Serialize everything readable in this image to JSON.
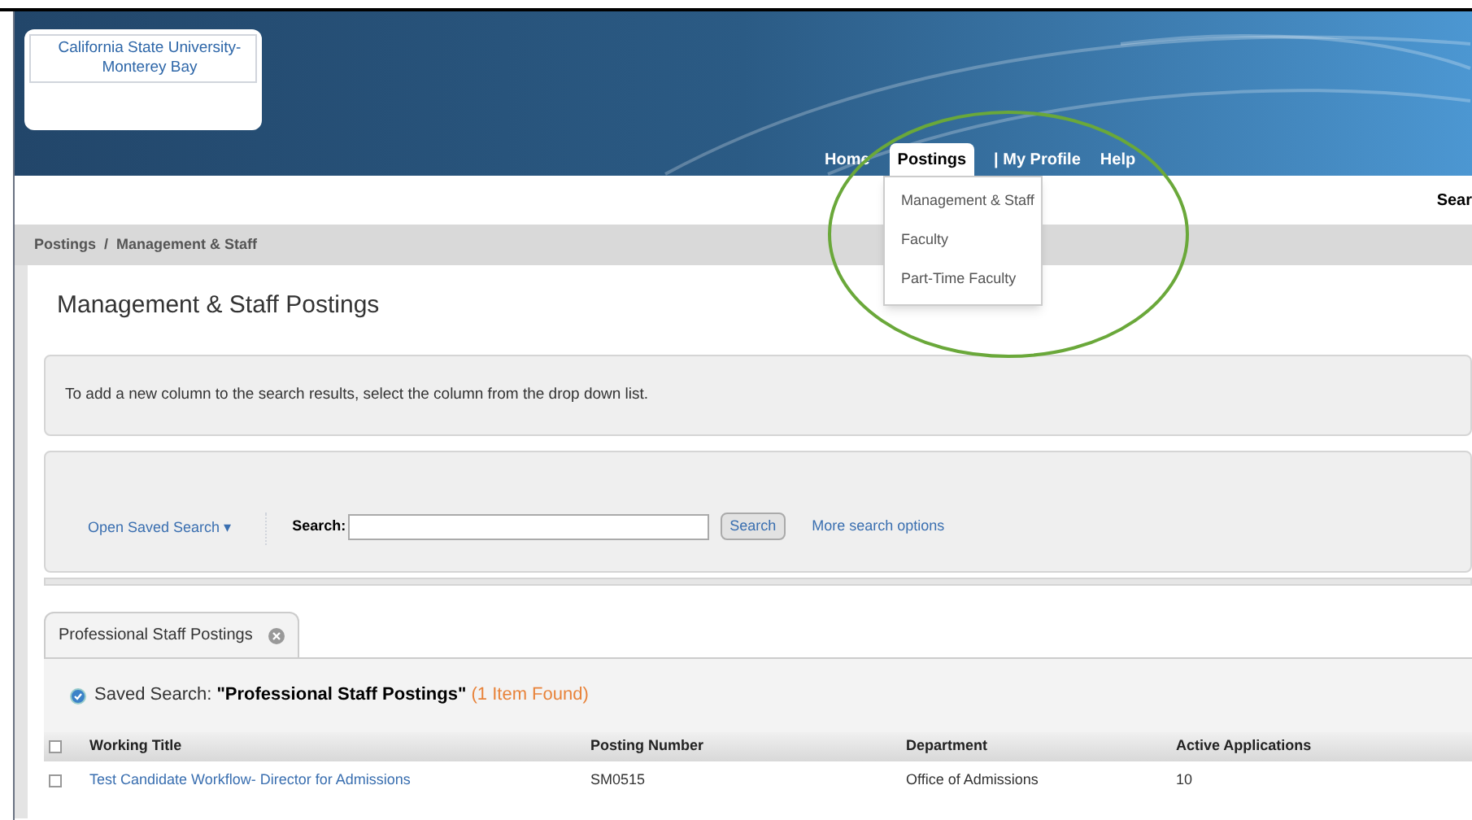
{
  "logo": {
    "alt_lines": [
      "California State University-",
      "Monterey Bay"
    ]
  },
  "nav": {
    "items": [
      {
        "label": "Home",
        "selected": false
      },
      {
        "label": "Postings",
        "selected": true
      },
      {
        "label": "| My Profile",
        "selected": false
      },
      {
        "label": "Help",
        "selected": false
      }
    ],
    "dropdown": [
      "Management & Staff",
      "Faculty",
      "Part-Time Faculty"
    ]
  },
  "header_search": "Sear",
  "breadcrumb": {
    "items": [
      "Postings",
      "Management & Staff"
    ],
    "separator": "/"
  },
  "page_title": "Management & Staff Postings",
  "info_text": "To add a new column to the search results, select the column from the drop down list.",
  "search": {
    "open_saved": "Open Saved Search ▾",
    "label": "Search:",
    "button": "Search",
    "more_link": "More search options"
  },
  "tabs": [
    {
      "label": "Professional Staff Postings",
      "selected": true,
      "closable": true
    }
  ],
  "saved_search": {
    "prefix": "Saved Search:",
    "name": "\"Professional Staff Postings\"",
    "count": "(1 Item Found)"
  },
  "table": {
    "select_all_checked": false,
    "columns": [
      "Working Title",
      "Posting Number",
      "Department",
      "Active Applications"
    ],
    "rows": [
      {
        "checked": false,
        "cells": [
          "Test Candidate Workflow- Director for Admissions",
          "SM0515",
          "Office of Admissions",
          "10"
        ]
      }
    ]
  }
}
